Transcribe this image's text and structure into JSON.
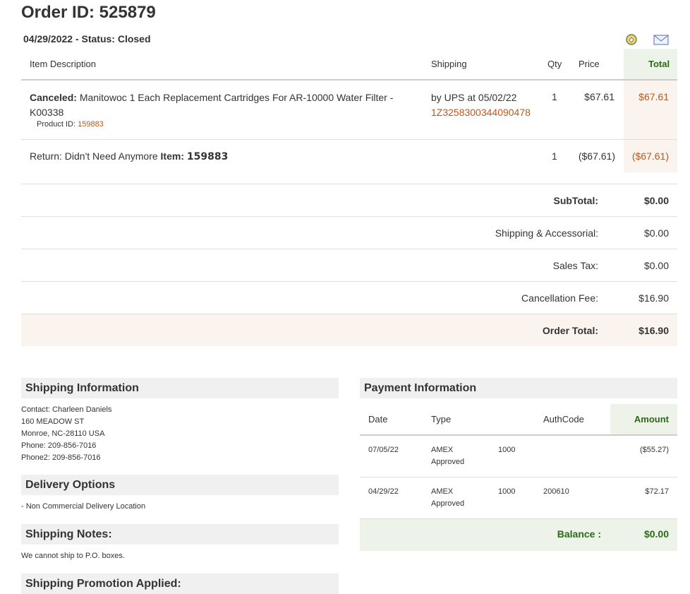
{
  "order": {
    "title": "Order ID: 525879",
    "date_status": "04/29/2022 - Status: Closed"
  },
  "icons": {
    "refresh": "refresh-edit-icon",
    "mail": "envelope-icon"
  },
  "items_table": {
    "headers": {
      "description": "Item Description",
      "shipping": "Shipping",
      "qty": "Qty",
      "price": "Price",
      "total": "Total"
    },
    "rows": [
      {
        "status": "Canceled:",
        "description_line1": "Manitowoc 1 Each Replacement Cartridges For AR-10000 Water Filter -",
        "description_line2": "K00338",
        "product_id_label": "Product ID:",
        "product_id": "159883",
        "shipping": "by UPS at 05/02/22",
        "tracking": "1Z3258300344090478",
        "qty": "1",
        "price": "$67.61",
        "total": "$67.61"
      },
      {
        "return_text": "Return: Didn't Need Anymore",
        "item_label": "Item:",
        "item_id": "159883",
        "qty": "1",
        "price": "($67.61)",
        "total": "($67.61)"
      }
    ]
  },
  "summary": {
    "subtotal_label": "SubTotal:",
    "subtotal": "$0.00",
    "shipping_label": "Shipping & Accessorial:",
    "shipping": "$0.00",
    "tax_label": "Sales Tax:",
    "tax": "$0.00",
    "cancel_label": "Cancellation Fee:",
    "cancel": "$16.90",
    "order_total_label": "Order Total:",
    "order_total": "$16.90"
  },
  "shipping_info": {
    "heading": "Shipping Information",
    "contact": "Contact: Charleen Daniels",
    "street": "160 MEADOW ST",
    "city": "Monroe, NC-28110 USA",
    "phone": "Phone: 209-856-7016",
    "phone2": "Phone2: 209-856-7016"
  },
  "delivery": {
    "heading": "Delivery Options",
    "text": "- Non Commercial Delivery Location"
  },
  "notes": {
    "heading": "Shipping Notes:",
    "text": "We cannot ship to P.O. boxes."
  },
  "promo": {
    "heading": "Shipping Promotion Applied:"
  },
  "payment": {
    "heading": "Payment Information",
    "headers": {
      "date": "Date",
      "type": "Type",
      "authcode": "AuthCode",
      "amount": "Amount"
    },
    "rows": [
      {
        "date": "07/05/22",
        "type": "AMEX",
        "status": "Approved",
        "code": "1000",
        "auth": "",
        "amount": "($55.27)"
      },
      {
        "date": "04/29/22",
        "type": "AMEX",
        "status": "Approved",
        "code": "1000",
        "auth": "200610",
        "amount": "$72.17"
      }
    ],
    "balance_label": "Balance :",
    "balance": "$0.00"
  }
}
